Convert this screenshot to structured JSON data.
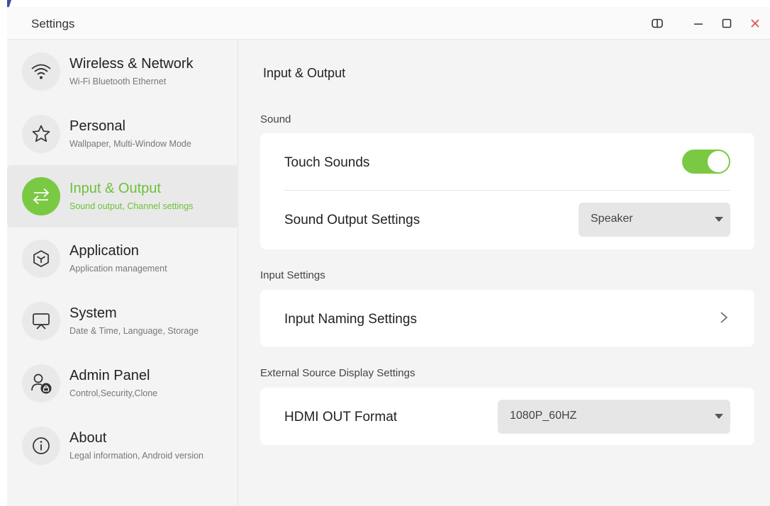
{
  "window": {
    "title": "Settings"
  },
  "titlebar_icons": [
    "split-screen-icon",
    "minimize-icon",
    "maximize-icon",
    "close-icon"
  ],
  "accent_color": "#7ac943",
  "sidebar": {
    "items": [
      {
        "title": "Wireless & Network",
        "subtitle": "Wi-Fi Bluetooth Ethernet",
        "icon": "wifi-icon",
        "active": false
      },
      {
        "title": "Personal",
        "subtitle": "Wallpaper, Multi-Window Mode",
        "icon": "star-icon",
        "active": false
      },
      {
        "title": "Input & Output",
        "subtitle": "Sound output, Channel settings",
        "icon": "swap-arrows-icon",
        "active": true
      },
      {
        "title": "Application",
        "subtitle": "Application management",
        "icon": "cube-icon",
        "active": false
      },
      {
        "title": "System",
        "subtitle": "Date & Time, Language, Storage",
        "icon": "monitor-icon",
        "active": false
      },
      {
        "title": "Admin Panel",
        "subtitle": "Control,Security,Clone",
        "icon": "admin-lock-icon",
        "active": false
      },
      {
        "title": "About",
        "subtitle": "Legal information, Android version",
        "icon": "info-icon",
        "active": false
      }
    ]
  },
  "main": {
    "title": "Input & Output",
    "sections": {
      "sound": {
        "label": "Sound",
        "touch_sounds": {
          "label": "Touch Sounds",
          "enabled": true
        },
        "sound_output": {
          "label": "Sound Output Settings",
          "value": "Speaker"
        }
      },
      "input": {
        "label": "Input Settings",
        "input_naming": {
          "label": "Input Naming Settings"
        }
      },
      "external": {
        "label": "External Source Display Settings",
        "hdmi_out": {
          "label": "HDMI OUT Format",
          "value": "1080P_60HZ"
        }
      }
    }
  }
}
